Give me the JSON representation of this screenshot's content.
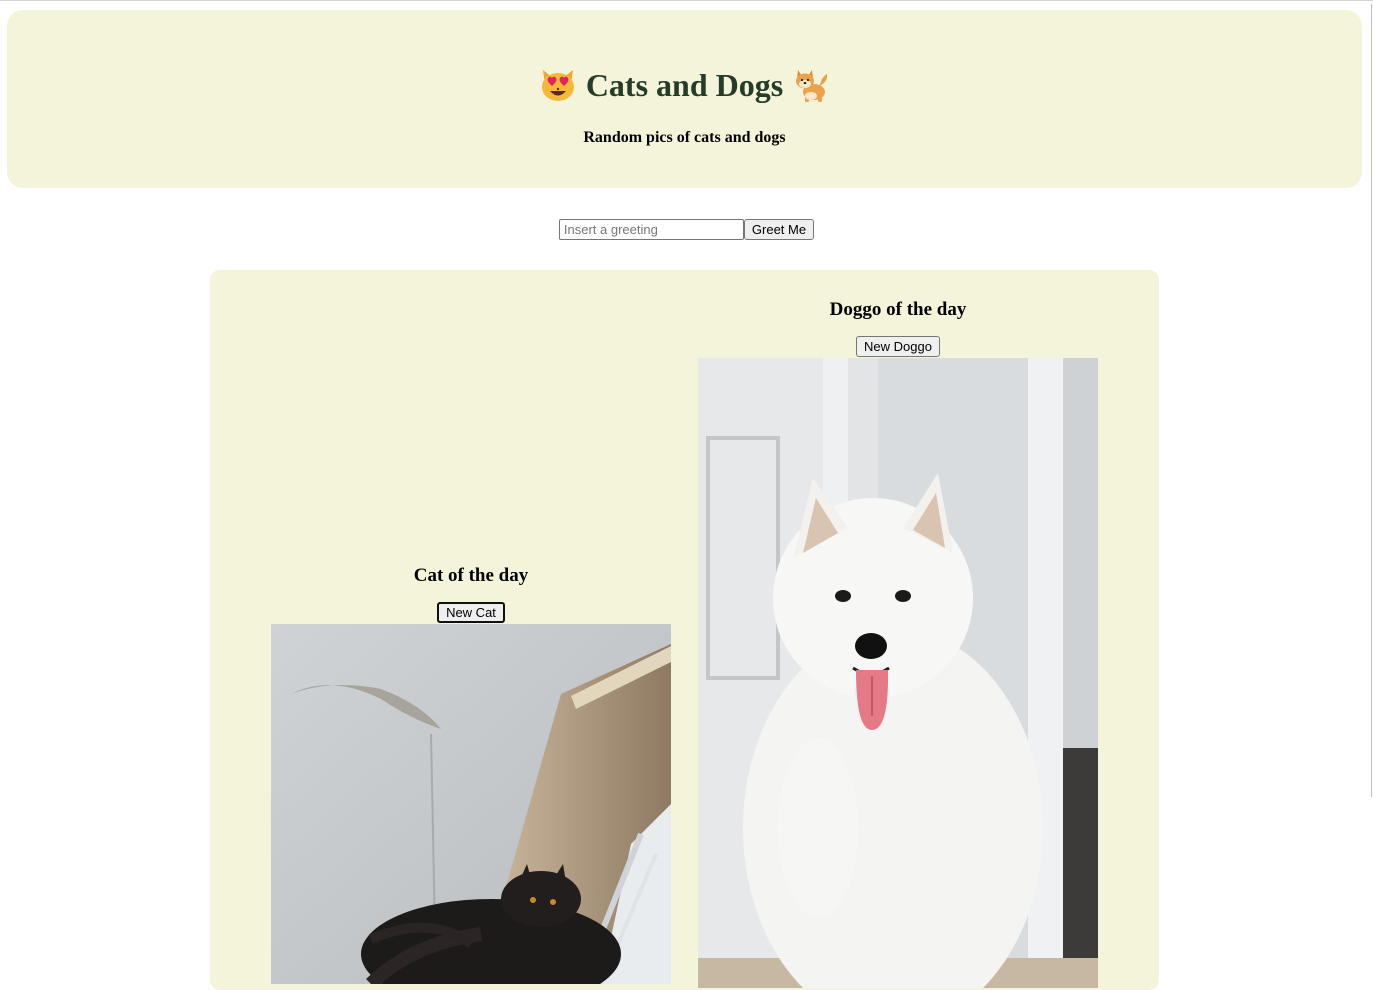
{
  "header": {
    "title": "Cats and Dogs",
    "title_left_icon": "heart-eyes-cat-icon",
    "title_right_icon": "shiba-dog-icon",
    "subtitle": "Random pics of cats and dogs"
  },
  "greeting": {
    "placeholder": "Insert a greeting",
    "value": "",
    "button_label": "Greet Me"
  },
  "cat_column": {
    "heading": "Cat of the day",
    "button_label": "New Cat",
    "photo": "black-cat-photo"
  },
  "dog_column": {
    "heading": "Doggo of the day",
    "button_label": "New Doggo",
    "photo": "samoyed-dog-photo"
  },
  "colors": {
    "panel_background": "#f3f4da",
    "title_color": "#243c28"
  }
}
